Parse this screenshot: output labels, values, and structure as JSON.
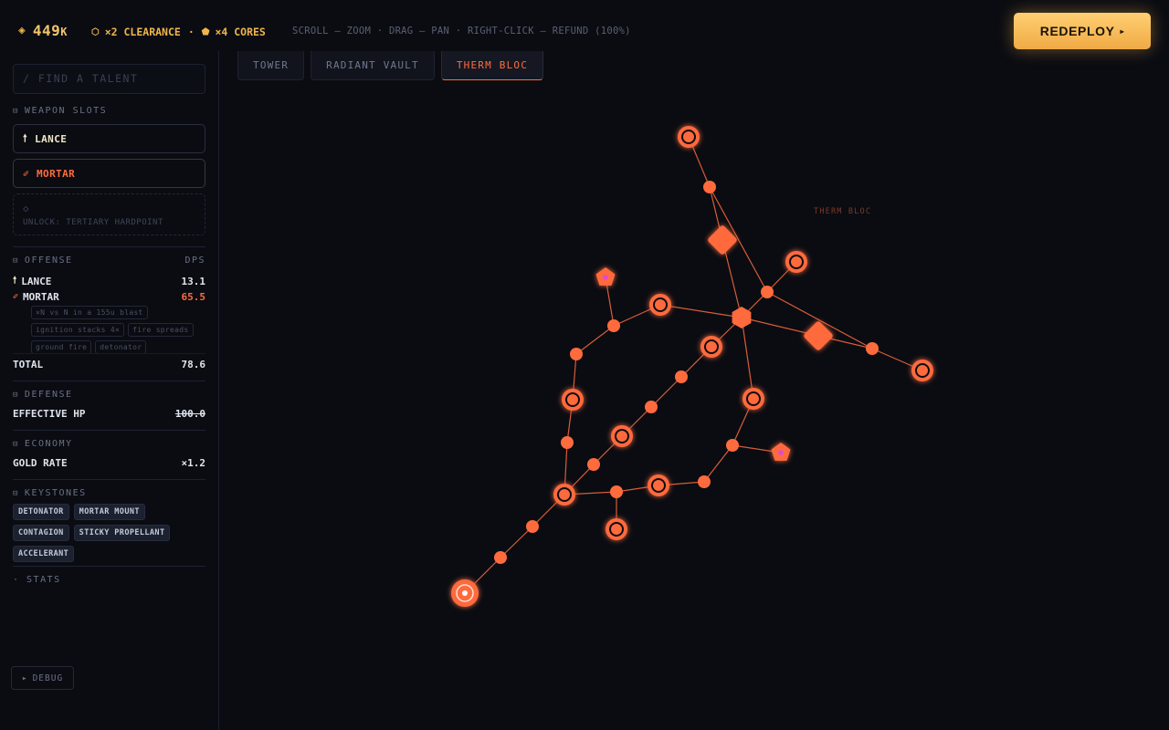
{
  "header": {
    "gold_value": "449",
    "gold_suffix": "K",
    "clearance": "×2 CLEARANCE",
    "separator": "·",
    "cores": "×4 CORES",
    "hint": "SCROLL — ZOOM · DRAG — PAN · RIGHT-CLICK — REFUND (100%)",
    "redeploy_label": "REDEPLOY",
    "redeploy_arrow": "▸"
  },
  "sidebar": {
    "search_placeholder": "/ FIND A TALENT",
    "weapon_slots": {
      "title": "WEAPON SLOTS",
      "slots": [
        {
          "label": "LANCE",
          "icon": "lance-icon",
          "glyph": "🠕"
        },
        {
          "label": "MORTAR",
          "icon": "mortar-icon",
          "glyph": "✐"
        }
      ],
      "locked_label": "UNLOCK: TERTIARY HARDPOINT",
      "locked_glyph": "◇"
    },
    "offense": {
      "title": "OFFENSE",
      "column": "DPS",
      "rows": [
        {
          "label": "LANCE",
          "value": "13.1",
          "glyph": "🠕"
        },
        {
          "label": "MORTAR",
          "value": "65.5",
          "glyph": "✐"
        }
      ],
      "mortar_chips": [
        "×N vs N in a 155u blast",
        "ignition stacks 4×",
        "fire spreads",
        "ground fire",
        "detonator"
      ],
      "total_label": "TOTAL",
      "total_value": "78.6"
    },
    "defense": {
      "title": "DEFENSE",
      "hp_label": "EFFECTIVE HP",
      "hp_value": "100.0"
    },
    "economy": {
      "title": "ECONOMY",
      "gold_rate_label": "GOLD RATE",
      "gold_rate_value": "×1.2"
    },
    "keystones": {
      "title": "KEYSTONES",
      "items": [
        "DETONATOR",
        "MORTAR MOUNT",
        "CONTAGION",
        "STICKY PROPELLANT",
        "ACCELERANT"
      ]
    },
    "stats_label": "· STATS",
    "debug_label": "DEBUG",
    "debug_glyph": "▸"
  },
  "tabs": [
    {
      "label": "TOWER",
      "active": false
    },
    {
      "label": "RADIANT VAULT",
      "active": false
    },
    {
      "label": "THERM BLOC",
      "active": true
    }
  ],
  "tree": {
    "label": "THERM BLOC",
    "accent": "#ff6b3d",
    "node_fill": "#ff6b3d",
    "gem_color": "#e44cc8"
  }
}
